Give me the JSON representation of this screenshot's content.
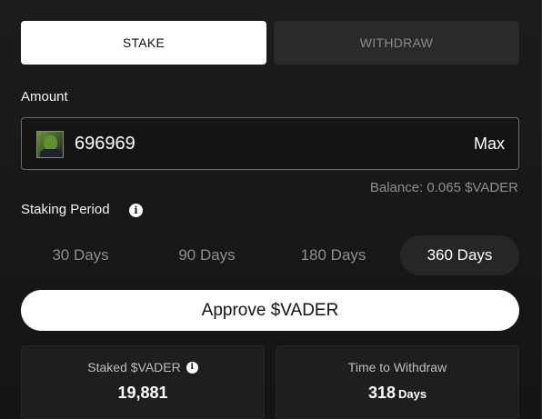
{
  "tabs": [
    {
      "label": "STAKE",
      "active": true
    },
    {
      "label": "WITHDRAW",
      "active": false
    }
  ],
  "amount": {
    "label": "Amount",
    "value": "696969",
    "max_label": "Max",
    "token_icon": "vader-token-avatar",
    "balance": "Balance: 0.065 $VADER"
  },
  "staking_period": {
    "label": "Staking Period",
    "info_icon": "info-icon",
    "options": [
      "30 Days",
      "90 Days",
      "180 Days",
      "360 Days"
    ],
    "selected": "360 Days"
  },
  "approve_button": "Approve $VADER",
  "stats": {
    "staked": {
      "title": "Staked $VADER",
      "value": "19,881"
    },
    "time_to_withdraw": {
      "title": "Time to Withdraw",
      "value": "318",
      "unit": "Days"
    }
  },
  "colors": {
    "background": "#1a1a1a",
    "active_tab": "#ffffff",
    "inactive_tab": "#2a2a2a",
    "muted_text": "#8e8e8e",
    "selected_period": "#262626"
  }
}
